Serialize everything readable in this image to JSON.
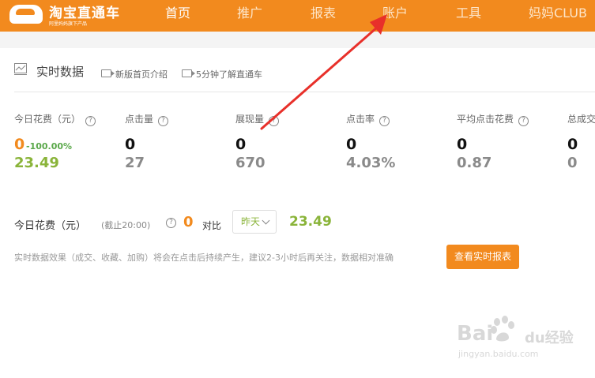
{
  "header": {
    "logo_title": "淘宝直通车",
    "logo_subtitle": "阿里妈妈旗下产品",
    "nav": [
      "首页",
      "推广",
      "报表",
      "账户",
      "工具",
      "妈妈CLUB"
    ]
  },
  "realtime": {
    "title": "实时数据",
    "links": [
      "新版首页介绍",
      "5分钟了解直通车"
    ]
  },
  "metrics": [
    {
      "label": "今日花费（元）",
      "value": "0",
      "change": "-100.00%",
      "prev": "23.49"
    },
    {
      "label": "点击量",
      "value": "0",
      "prev": "27"
    },
    {
      "label": "展现量",
      "value": "0",
      "prev": "670"
    },
    {
      "label": "点击率",
      "value": "0",
      "prev": "4.03%"
    },
    {
      "label": "平均点击花费",
      "value": "0",
      "prev": "0.87"
    },
    {
      "label": "总成交",
      "value": "0",
      "prev": "0"
    }
  ],
  "today_spend": {
    "label": "今日花费（元）",
    "deadline": "(截止20:00)",
    "value": "0",
    "compare_label": "对比",
    "compare_select": "昨天",
    "compare_value": "23.49"
  },
  "note": "实时数据效果（成交、收藏、加购）将会在点击后持续产生，建议2-3小时后再关注，数据相对准确",
  "report_button": "查看实时报表",
  "watermark": {
    "brand": "Bai",
    "brand2": "du",
    "cn": "经验",
    "site": "jingyan.baidu.com"
  },
  "colors": {
    "brand_orange": "#f28a1e",
    "positive_green": "#8ab43a",
    "arrow_red": "#e8302a"
  }
}
